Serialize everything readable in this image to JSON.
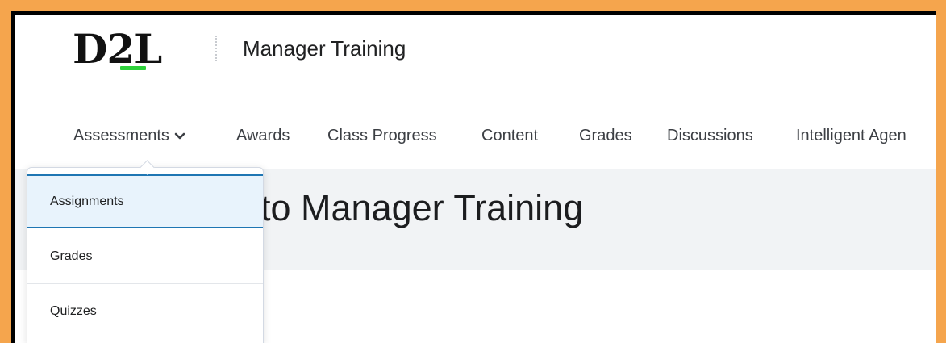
{
  "header": {
    "logo": "D2L",
    "course_title": "Manager Training"
  },
  "nav": {
    "items": [
      {
        "label": "Assessments",
        "has_dropdown": true
      },
      {
        "label": "Awards"
      },
      {
        "label": "Class Progress"
      },
      {
        "label": "Content"
      },
      {
        "label": "Grades"
      },
      {
        "label": "Discussions"
      },
      {
        "label": "Intelligent Agen"
      }
    ]
  },
  "banner": {
    "title": "to Manager Training"
  },
  "dropdown": {
    "items": [
      {
        "label": "Assignments",
        "active": true
      },
      {
        "label": "Grades"
      },
      {
        "label": "Quizzes"
      }
    ]
  },
  "colors": {
    "frame_orange": "#f5a54d",
    "logo_green": "#2ed13b",
    "active_highlight": "#e8f3fc",
    "active_border": "#1e76b3"
  },
  "icons": {
    "dropdown_chevron": "chevron-down-icon"
  }
}
